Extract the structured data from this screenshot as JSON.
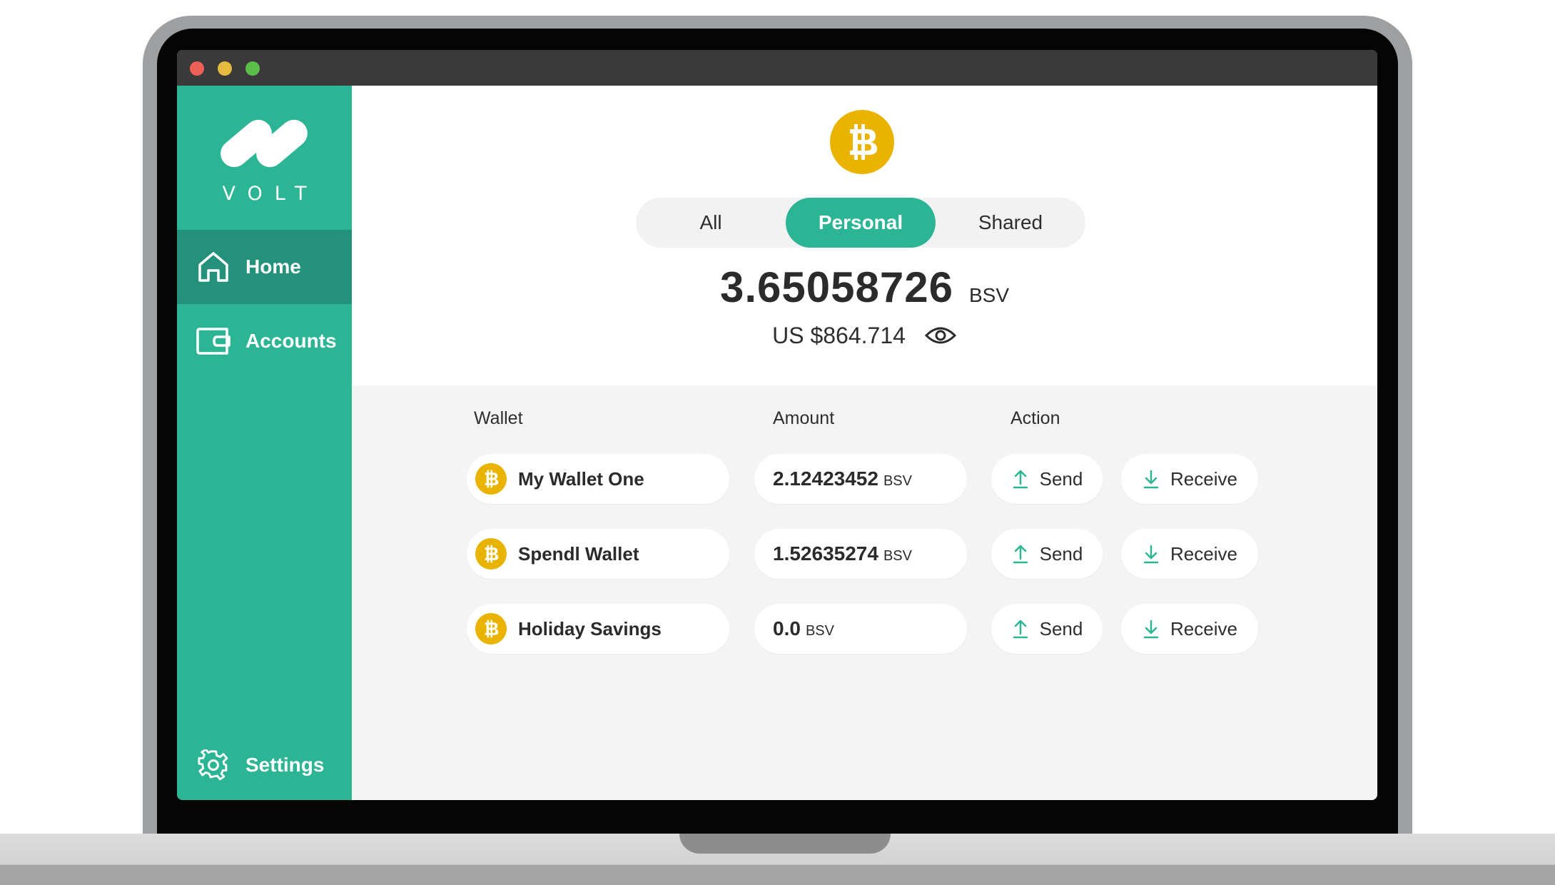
{
  "app": {
    "logo_text": "VOLT"
  },
  "sidebar": {
    "items": [
      {
        "label": "Home",
        "icon": "home-icon",
        "active": true
      },
      {
        "label": "Accounts",
        "icon": "wallet-icon",
        "active": false
      }
    ],
    "settings_label": "Settings"
  },
  "header": {
    "coin_icon": "bitcoin-icon",
    "tabs": [
      {
        "label": "All",
        "active": false
      },
      {
        "label": "Personal",
        "active": true
      },
      {
        "label": "Shared",
        "active": false
      }
    ],
    "balance": "3.65058726",
    "balance_unit": "BSV",
    "fiat": "US $864.714"
  },
  "table": {
    "headers": {
      "wallet": "Wallet",
      "amount": "Amount",
      "action": "Action"
    },
    "rows": [
      {
        "name": "My Wallet One",
        "amount": "2.12423452",
        "unit": "BSV",
        "send": "Send",
        "receive": "Receive"
      },
      {
        "name": "Spendl Wallet",
        "amount": "1.52635274",
        "unit": "BSV",
        "send": "Send",
        "receive": "Receive"
      },
      {
        "name": "Holiday Savings",
        "amount": "0.0",
        "unit": "BSV",
        "send": "Send",
        "receive": "Receive"
      }
    ]
  },
  "colors": {
    "brand_green": "#2bb594",
    "brand_green_dark": "#24927a",
    "bitcoin_gold": "#eab300",
    "titlebar": "#3a3a3a"
  }
}
